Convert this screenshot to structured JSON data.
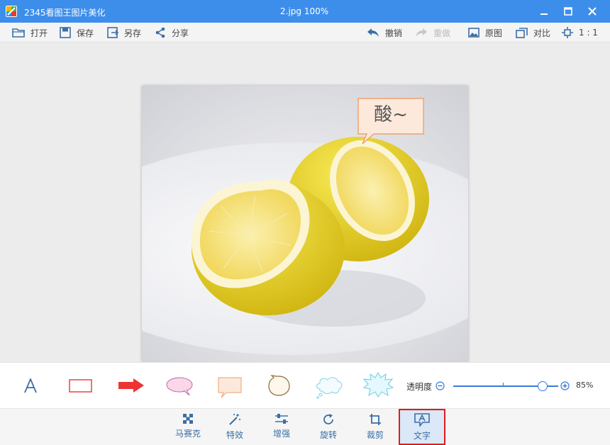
{
  "window": {
    "app_title": "2345看图王图片美化",
    "document_title": "2.jpg  100%",
    "buttons": [
      "minimize",
      "maximize",
      "close"
    ]
  },
  "toolbar": {
    "open": "打开",
    "save": "保存",
    "save_as": "另存",
    "share": "分享",
    "undo": "撤销",
    "redo": "重做",
    "original": "原图",
    "compare": "对比",
    "actual_size": "1 : 1"
  },
  "canvas": {
    "bubble_text": "酸~"
  },
  "shape_panel": {
    "shapes": [
      "text",
      "rectangle",
      "arrow",
      "oval-speech-bubble",
      "rect-speech-bubble",
      "round-speech-bubble",
      "cloud-bubble",
      "burst-bubble"
    ],
    "opacity_label": "透明度",
    "opacity_value": "85%",
    "opacity_level": 0.85
  },
  "tools": {
    "mosaic": "马赛克",
    "effects": "特效",
    "enhance": "增强",
    "rotate": "旋转",
    "crop": "裁剪",
    "text": "文字",
    "active": "text"
  },
  "colors": {
    "title_bar": "#3d8eeb",
    "accent": "#3a7bd5",
    "arrow_red": "#ee3333",
    "highlight_border": "#e21b1b"
  }
}
